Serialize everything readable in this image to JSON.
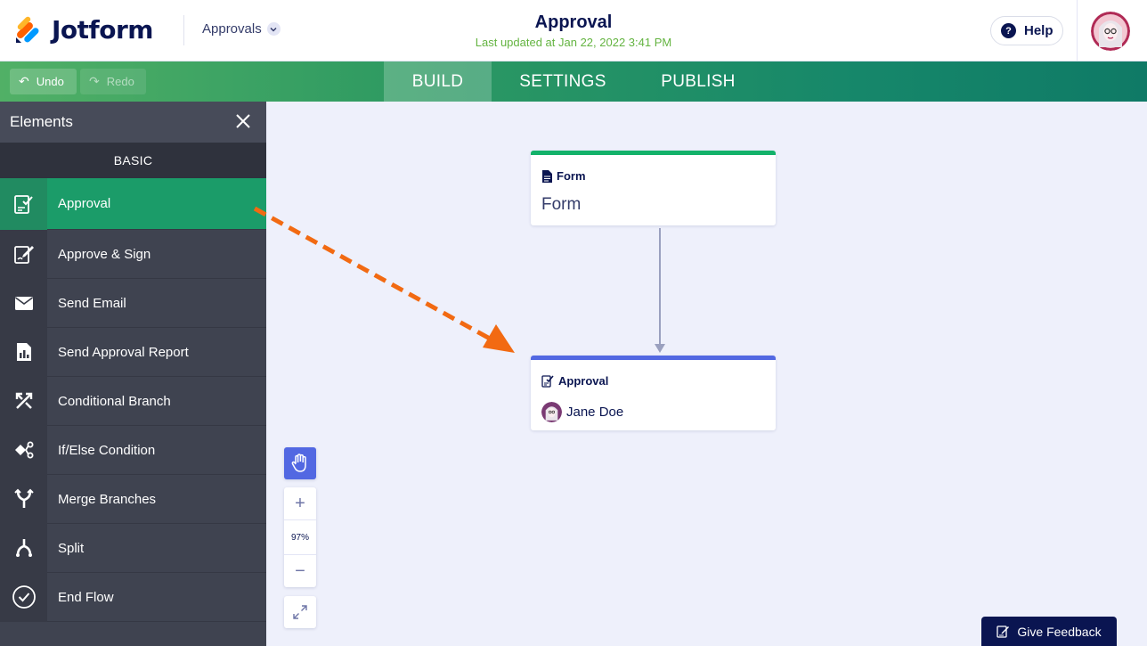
{
  "header": {
    "logo_text": "Jotform",
    "app_switcher_label": "Approvals",
    "title": "Approval",
    "last_updated": "Last updated at Jan 22, 2022 3:41 PM",
    "help_label": "Help"
  },
  "toolbar": {
    "undo_label": "Undo",
    "redo_label": "Redo",
    "tabs": [
      {
        "label": "BUILD",
        "active": true
      },
      {
        "label": "SETTINGS",
        "active": false
      },
      {
        "label": "PUBLISH",
        "active": false
      }
    ]
  },
  "sidebar": {
    "title": "Elements",
    "category": "BASIC",
    "items": [
      {
        "label": "Approval",
        "icon": "approval-icon",
        "active": true
      },
      {
        "label": "Approve & Sign",
        "icon": "approve-sign-icon"
      },
      {
        "label": "Send Email",
        "icon": "envelope-icon"
      },
      {
        "label": "Send Approval Report",
        "icon": "report-icon"
      },
      {
        "label": "Conditional Branch",
        "icon": "branch-icon"
      },
      {
        "label": "If/Else Condition",
        "icon": "if-else-icon"
      },
      {
        "label": "Merge Branches",
        "icon": "merge-icon"
      },
      {
        "label": "Split",
        "icon": "split-icon"
      },
      {
        "label": "End Flow",
        "icon": "check-circle-icon"
      }
    ]
  },
  "canvas": {
    "form_node": {
      "type_label": "Form",
      "name": "Form"
    },
    "approval_node": {
      "type_label": "Approval",
      "assignee": "Jane Doe"
    },
    "zoom": {
      "in_label": "+",
      "level": "97%",
      "out_label": "−"
    },
    "feedback_label": "Give Feedback"
  },
  "colors": {
    "brand_green": "#1b9c69",
    "approval_blue": "#5268e2",
    "form_green": "#13b26a",
    "annotation_orange": "#f26a12",
    "navy": "#0a1551"
  }
}
